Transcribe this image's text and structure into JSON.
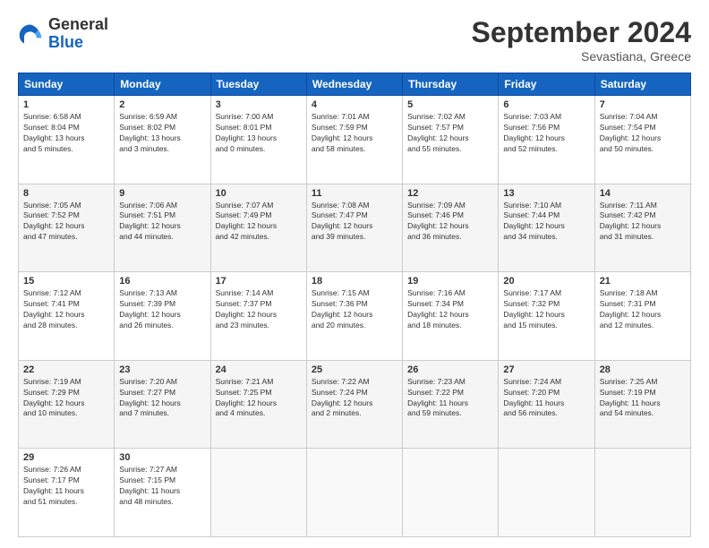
{
  "logo": {
    "general": "General",
    "blue": "Blue"
  },
  "header": {
    "month": "September 2024",
    "location": "Sevastiana, Greece"
  },
  "weekdays": [
    "Sunday",
    "Monday",
    "Tuesday",
    "Wednesday",
    "Thursday",
    "Friday",
    "Saturday"
  ],
  "weeks": [
    [
      {
        "day": "1",
        "info": "Sunrise: 6:58 AM\nSunset: 8:04 PM\nDaylight: 13 hours\nand 5 minutes."
      },
      {
        "day": "2",
        "info": "Sunrise: 6:59 AM\nSunset: 8:02 PM\nDaylight: 13 hours\nand 3 minutes."
      },
      {
        "day": "3",
        "info": "Sunrise: 7:00 AM\nSunset: 8:01 PM\nDaylight: 13 hours\nand 0 minutes."
      },
      {
        "day": "4",
        "info": "Sunrise: 7:01 AM\nSunset: 7:59 PM\nDaylight: 12 hours\nand 58 minutes."
      },
      {
        "day": "5",
        "info": "Sunrise: 7:02 AM\nSunset: 7:57 PM\nDaylight: 12 hours\nand 55 minutes."
      },
      {
        "day": "6",
        "info": "Sunrise: 7:03 AM\nSunset: 7:56 PM\nDaylight: 12 hours\nand 52 minutes."
      },
      {
        "day": "7",
        "info": "Sunrise: 7:04 AM\nSunset: 7:54 PM\nDaylight: 12 hours\nand 50 minutes."
      }
    ],
    [
      {
        "day": "8",
        "info": "Sunrise: 7:05 AM\nSunset: 7:52 PM\nDaylight: 12 hours\nand 47 minutes."
      },
      {
        "day": "9",
        "info": "Sunrise: 7:06 AM\nSunset: 7:51 PM\nDaylight: 12 hours\nand 44 minutes."
      },
      {
        "day": "10",
        "info": "Sunrise: 7:07 AM\nSunset: 7:49 PM\nDaylight: 12 hours\nand 42 minutes."
      },
      {
        "day": "11",
        "info": "Sunrise: 7:08 AM\nSunset: 7:47 PM\nDaylight: 12 hours\nand 39 minutes."
      },
      {
        "day": "12",
        "info": "Sunrise: 7:09 AM\nSunset: 7:46 PM\nDaylight: 12 hours\nand 36 minutes."
      },
      {
        "day": "13",
        "info": "Sunrise: 7:10 AM\nSunset: 7:44 PM\nDaylight: 12 hours\nand 34 minutes."
      },
      {
        "day": "14",
        "info": "Sunrise: 7:11 AM\nSunset: 7:42 PM\nDaylight: 12 hours\nand 31 minutes."
      }
    ],
    [
      {
        "day": "15",
        "info": "Sunrise: 7:12 AM\nSunset: 7:41 PM\nDaylight: 12 hours\nand 28 minutes."
      },
      {
        "day": "16",
        "info": "Sunrise: 7:13 AM\nSunset: 7:39 PM\nDaylight: 12 hours\nand 26 minutes."
      },
      {
        "day": "17",
        "info": "Sunrise: 7:14 AM\nSunset: 7:37 PM\nDaylight: 12 hours\nand 23 minutes."
      },
      {
        "day": "18",
        "info": "Sunrise: 7:15 AM\nSunset: 7:36 PM\nDaylight: 12 hours\nand 20 minutes."
      },
      {
        "day": "19",
        "info": "Sunrise: 7:16 AM\nSunset: 7:34 PM\nDaylight: 12 hours\nand 18 minutes."
      },
      {
        "day": "20",
        "info": "Sunrise: 7:17 AM\nSunset: 7:32 PM\nDaylight: 12 hours\nand 15 minutes."
      },
      {
        "day": "21",
        "info": "Sunrise: 7:18 AM\nSunset: 7:31 PM\nDaylight: 12 hours\nand 12 minutes."
      }
    ],
    [
      {
        "day": "22",
        "info": "Sunrise: 7:19 AM\nSunset: 7:29 PM\nDaylight: 12 hours\nand 10 minutes."
      },
      {
        "day": "23",
        "info": "Sunrise: 7:20 AM\nSunset: 7:27 PM\nDaylight: 12 hours\nand 7 minutes."
      },
      {
        "day": "24",
        "info": "Sunrise: 7:21 AM\nSunset: 7:25 PM\nDaylight: 12 hours\nand 4 minutes."
      },
      {
        "day": "25",
        "info": "Sunrise: 7:22 AM\nSunset: 7:24 PM\nDaylight: 12 hours\nand 2 minutes."
      },
      {
        "day": "26",
        "info": "Sunrise: 7:23 AM\nSunset: 7:22 PM\nDaylight: 11 hours\nand 59 minutes."
      },
      {
        "day": "27",
        "info": "Sunrise: 7:24 AM\nSunset: 7:20 PM\nDaylight: 11 hours\nand 56 minutes."
      },
      {
        "day": "28",
        "info": "Sunrise: 7:25 AM\nSunset: 7:19 PM\nDaylight: 11 hours\nand 54 minutes."
      }
    ],
    [
      {
        "day": "29",
        "info": "Sunrise: 7:26 AM\nSunset: 7:17 PM\nDaylight: 11 hours\nand 51 minutes."
      },
      {
        "day": "30",
        "info": "Sunrise: 7:27 AM\nSunset: 7:15 PM\nDaylight: 11 hours\nand 48 minutes."
      },
      null,
      null,
      null,
      null,
      null
    ]
  ]
}
